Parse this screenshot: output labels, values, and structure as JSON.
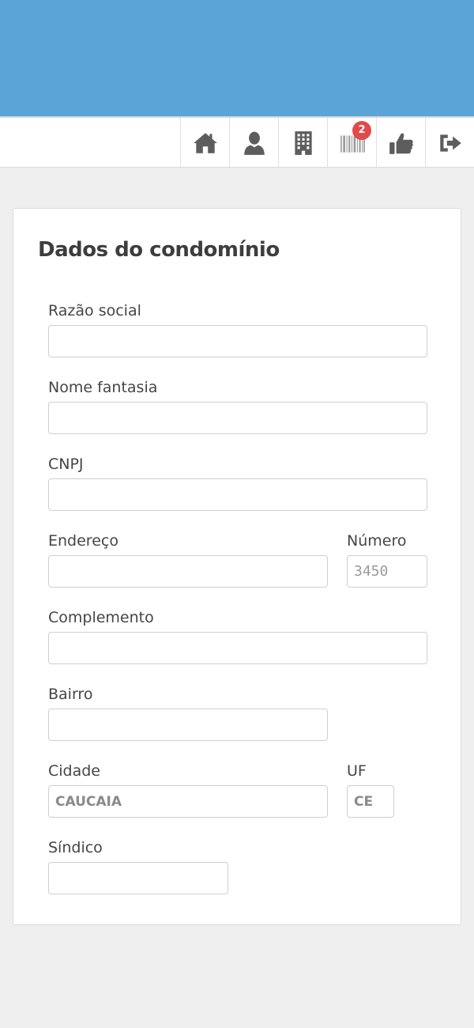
{
  "nav": {
    "items": [
      {
        "name": "home",
        "icon": "home-icon"
      },
      {
        "name": "profile",
        "icon": "user-icon"
      },
      {
        "name": "building",
        "icon": "building-icon"
      },
      {
        "name": "boletos",
        "icon": "barcode-icon",
        "badge": "2"
      },
      {
        "name": "like",
        "icon": "thumbs-up-icon"
      },
      {
        "name": "logout",
        "icon": "sign-out-icon"
      }
    ]
  },
  "form": {
    "title": "Dados do condomínio",
    "razao_social": {
      "label": "Razão social",
      "value": ""
    },
    "nome_fantasia": {
      "label": "Nome fantasia",
      "value": ""
    },
    "cnpj": {
      "label": "CNPJ",
      "value": ""
    },
    "endereco": {
      "label": "Endereço",
      "value": ""
    },
    "numero": {
      "label": "Número",
      "value": "3450"
    },
    "complemento": {
      "label": "Complemento",
      "value": ""
    },
    "bairro": {
      "label": "Bairro",
      "value": ""
    },
    "cidade": {
      "label": "Cidade",
      "value": "CAUCAIA"
    },
    "uf": {
      "label": "UF",
      "value": "CE"
    },
    "sindico": {
      "label": "Síndico",
      "value": ""
    }
  },
  "colors": {
    "banner": "#5aa4d8",
    "badge": "#e04a4a",
    "icon": "#5d5d5d"
  }
}
